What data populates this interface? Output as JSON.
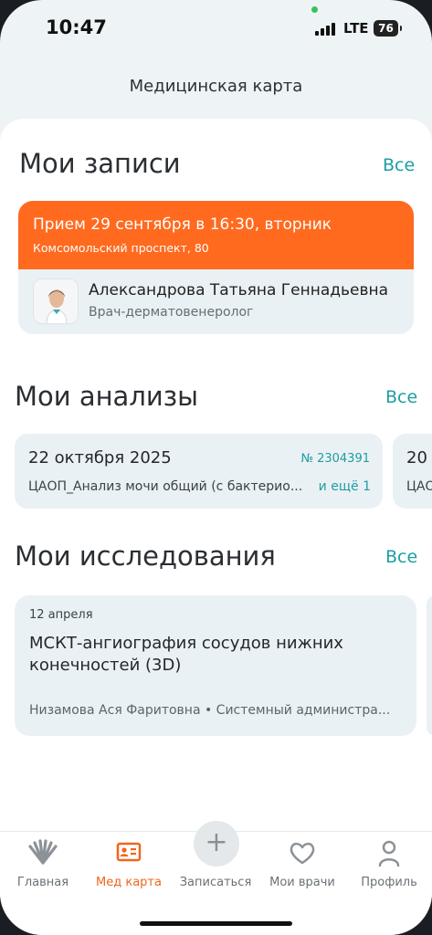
{
  "status_bar": {
    "time": "10:47",
    "network": "LTE",
    "battery": "76"
  },
  "header": {
    "title": "Медицинская карта"
  },
  "appointments": {
    "title": "Мои записи",
    "see_all": "Все",
    "card": {
      "title": "Прием 29 сентября в 16:30, вторник",
      "address": "Комсомольский проспект, 80",
      "doctor_name": "Александрова Татьяна Геннадьевна",
      "doctor_role": "Врач-дерматовенеролог"
    }
  },
  "analyses": {
    "title": "Мои анализы",
    "see_all": "Все",
    "cards": [
      {
        "date": "22 октября 2025",
        "number": "№ 2304391",
        "description": "ЦАОП_Анализ мочи общий (с бактерио...",
        "more": "и ещё 1"
      },
      {
        "date": "20",
        "number": "",
        "description": "ЦАО",
        "more": ""
      }
    ]
  },
  "research": {
    "title": "Мои исследования",
    "see_all": "Все",
    "cards": [
      {
        "date": "12 апреля",
        "title": "МСКТ-ангиография сосудов нижних конечностей (3D)",
        "meta": "Низамова Ася Фаритовна • Системный администра..."
      }
    ]
  },
  "tabbar": {
    "items": [
      {
        "label": "Главная",
        "icon": "shell-logo-icon"
      },
      {
        "label": "Мед карта",
        "icon": "medical-card-icon",
        "active": true
      },
      {
        "label": "Записаться",
        "icon": "plus-icon"
      },
      {
        "label": "Мои врачи",
        "icon": "heart-icon"
      },
      {
        "label": "Профиль",
        "icon": "person-icon"
      }
    ]
  },
  "colors": {
    "accent_orange": "#ff6a1f",
    "link_teal": "#1d9ea3",
    "card_bg": "#eaf1f4",
    "page_bg": "#eef3f5"
  }
}
